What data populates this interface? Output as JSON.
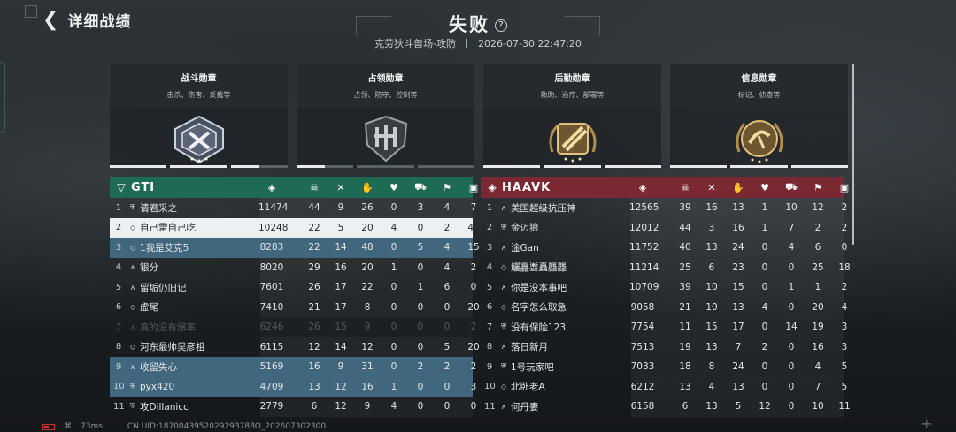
{
  "header": {
    "back_label": "详细战绩",
    "result": "失败",
    "help": "?",
    "map_mode": "克劳狄斗兽场-攻防",
    "datetime": "2026-07-30 22:47:20"
  },
  "medals": [
    {
      "name": "战斗勋章",
      "desc": "击杀、伤害、反截等",
      "icon": "combat-medal-icon",
      "progress": [
        1,
        1,
        0.5
      ],
      "color": "#b9c4d6"
    },
    {
      "name": "占领勋章",
      "desc": "占领、防守、控制等",
      "icon": "capture-medal-icon",
      "progress": [
        0.5,
        0,
        0
      ],
      "color": "#aeb3b7"
    },
    {
      "name": "后勤勋章",
      "desc": "救助、治疗、部署等",
      "icon": "logistics-medal-icon",
      "progress": [
        1,
        1,
        1
      ],
      "color": "#c9a55b"
    },
    {
      "name": "信息勋章",
      "desc": "标记、侦查等",
      "icon": "intel-medal-icon",
      "progress": [
        1,
        1,
        1
      ],
      "color": "#c9a55b"
    }
  ],
  "column_icons": [
    "score-icon",
    "kills-icon",
    "deaths-icon",
    "assists-icon",
    "revives-icon",
    "vehicle-icon",
    "capture-icon",
    "intel-icon"
  ],
  "teams": [
    {
      "name": "GTI",
      "color": "#1e6b55",
      "players": [
        {
          "rank": "1",
          "class": "medic",
          "name": "请君采之",
          "stats": [
            "11474",
            "44",
            "9",
            "26",
            "0",
            "3",
            "4",
            "7"
          ],
          "style": "normal"
        },
        {
          "rank": "2",
          "class": "support",
          "name": "自己雷自己吃",
          "stats": [
            "10248",
            "22",
            "5",
            "20",
            "4",
            "0",
            "2",
            "40"
          ],
          "style": "self"
        },
        {
          "rank": "3",
          "class": "support",
          "name": "1我是艾克5",
          "stats": [
            "8283",
            "22",
            "14",
            "48",
            "0",
            "5",
            "4",
            "15"
          ],
          "style": "friend"
        },
        {
          "rank": "4",
          "class": "assault",
          "name": "银分",
          "stats": [
            "8020",
            "29",
            "16",
            "20",
            "1",
            "0",
            "4",
            "2"
          ],
          "style": "normal"
        },
        {
          "rank": "5",
          "class": "assault",
          "name": "留垢仍旧记",
          "stats": [
            "7601",
            "26",
            "17",
            "22",
            "0",
            "1",
            "6",
            "0"
          ],
          "style": "normal"
        },
        {
          "rank": "6",
          "class": "support",
          "name": "虚尾",
          "stats": [
            "7410",
            "21",
            "17",
            "8",
            "0",
            "0",
            "0",
            "20"
          ],
          "style": "normal"
        },
        {
          "rank": "7",
          "class": "assault",
          "name": "真的没有爆率",
          "stats": [
            "6246",
            "26",
            "15",
            "9",
            "0",
            "0",
            "0",
            "2"
          ],
          "style": "dim"
        },
        {
          "rank": "8",
          "class": "support",
          "name": "河东最帅吴彦祖",
          "stats": [
            "6115",
            "12",
            "14",
            "12",
            "0",
            "0",
            "5",
            "20"
          ],
          "style": "normal"
        },
        {
          "rank": "9",
          "class": "assault",
          "name": "收留失心",
          "stats": [
            "5169",
            "16",
            "9",
            "31",
            "0",
            "2",
            "2",
            "2"
          ],
          "style": "friend"
        },
        {
          "rank": "10",
          "class": "medic",
          "name": "pyx420",
          "stats": [
            "4709",
            "13",
            "12",
            "16",
            "1",
            "0",
            "0",
            "3"
          ],
          "style": "friend"
        },
        {
          "rank": "11",
          "class": "medic",
          "name": "攻Dillanicc",
          "stats": [
            "2779",
            "6",
            "12",
            "9",
            "4",
            "0",
            "0",
            "0"
          ],
          "style": "normal"
        }
      ]
    },
    {
      "name": "HAAVK",
      "color": "#7a2832",
      "players": [
        {
          "rank": "1",
          "class": "assault",
          "name": "美国超级抗压神",
          "stats": [
            "12565",
            "39",
            "16",
            "13",
            "1",
            "10",
            "12",
            "2"
          ],
          "style": "normal"
        },
        {
          "rank": "2",
          "class": "medic",
          "name": "金迈狼",
          "stats": [
            "12012",
            "44",
            "3",
            "16",
            "1",
            "7",
            "2",
            "2"
          ],
          "style": "normal"
        },
        {
          "rank": "3",
          "class": "assault",
          "name": "淦Gan",
          "stats": [
            "11752",
            "40",
            "13",
            "24",
            "0",
            "4",
            "6",
            "0"
          ],
          "style": "normal"
        },
        {
          "rank": "4",
          "class": "support",
          "name": "鱺靐聻矗龘龘",
          "stats": [
            "11214",
            "25",
            "6",
            "23",
            "0",
            "0",
            "25",
            "18"
          ],
          "style": "normal"
        },
        {
          "rank": "5",
          "class": "assault",
          "name": "你是没本事吧",
          "stats": [
            "10709",
            "39",
            "10",
            "15",
            "0",
            "1",
            "1",
            "2"
          ],
          "style": "normal"
        },
        {
          "rank": "6",
          "class": "support",
          "name": "名字怎么取急",
          "stats": [
            "9058",
            "21",
            "10",
            "13",
            "4",
            "0",
            "20",
            "4"
          ],
          "style": "normal"
        },
        {
          "rank": "7",
          "class": "medic",
          "name": "没有保险123",
          "stats": [
            "7754",
            "11",
            "15",
            "17",
            "0",
            "14",
            "19",
            "3"
          ],
          "style": "normal"
        },
        {
          "rank": "8",
          "class": "assault",
          "name": "落日新月",
          "stats": [
            "7513",
            "19",
            "13",
            "7",
            "2",
            "0",
            "16",
            "3"
          ],
          "style": "normal"
        },
        {
          "rank": "9",
          "class": "medic",
          "name": "1号玩家吧",
          "stats": [
            "7033",
            "18",
            "8",
            "24",
            "0",
            "0",
            "4",
            "5"
          ],
          "style": "normal"
        },
        {
          "rank": "10",
          "class": "support",
          "name": "北卧老A",
          "stats": [
            "6212",
            "13",
            "4",
            "13",
            "0",
            "0",
            "7",
            "5"
          ],
          "style": "normal"
        },
        {
          "rank": "11",
          "class": "assault",
          "name": "何丹妻",
          "stats": [
            "6158",
            "6",
            "13",
            "5",
            "12",
            "0",
            "10",
            "11"
          ],
          "style": "normal"
        }
      ]
    }
  ],
  "footer": {
    "ping": "73ms",
    "uid": "CN UID:1870043952029293788O_202607302300"
  }
}
